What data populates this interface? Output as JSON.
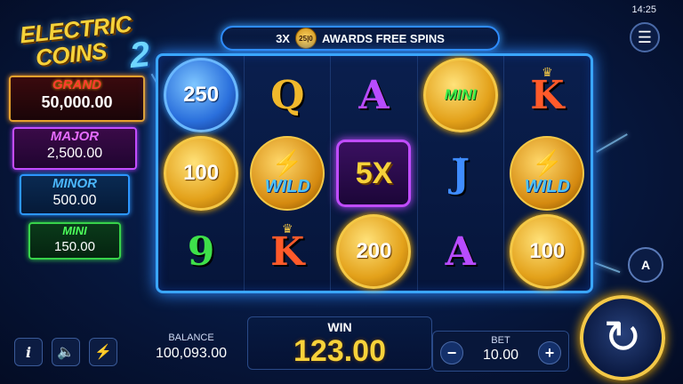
{
  "status_bar": {
    "time": "14:25"
  },
  "logo": {
    "line1": "ELECTRIC",
    "line2": "COINS",
    "number": "2"
  },
  "jackpots": {
    "grand": {
      "label": "GRAND",
      "value": "50,000.00"
    },
    "major": {
      "label": "MAJOR",
      "value": "2,500.00"
    },
    "minor": {
      "label": "MINOR",
      "value": "500.00"
    },
    "mini": {
      "label": "MINI",
      "value": "150.00"
    }
  },
  "banner": {
    "count": "3X",
    "coin_text": "25|0",
    "text": "AWARDS FREE SPINS"
  },
  "reels": {
    "row1": [
      "250",
      "Q",
      "A",
      "MINI",
      "K"
    ],
    "row2": [
      "100",
      "WILD",
      "5X",
      "J",
      "WILD"
    ],
    "row3": [
      "9",
      "K",
      "200",
      "A",
      "100"
    ]
  },
  "icons": {
    "menu": "☰",
    "info": "i",
    "sound": "🔈",
    "turbo": "⚡",
    "autoplay": "A",
    "spin": "↻",
    "minus": "−",
    "plus": "+",
    "bolt": "⚡",
    "crown": "♛",
    "fleur": "⚜"
  },
  "bottom_bar": {
    "balance_label": "BALANCE",
    "balance_value": "100,093.00",
    "win_label": "WIN",
    "win_value": "123.00",
    "bet_label": "BET",
    "bet_value": "10.00"
  },
  "colors": {
    "accent_blue": "#3aa6ff",
    "gold": "#f7d23a",
    "grand": "#ff3b30",
    "major": "#e66cff",
    "minor": "#4cb8ff",
    "mini": "#4cff5a"
  }
}
